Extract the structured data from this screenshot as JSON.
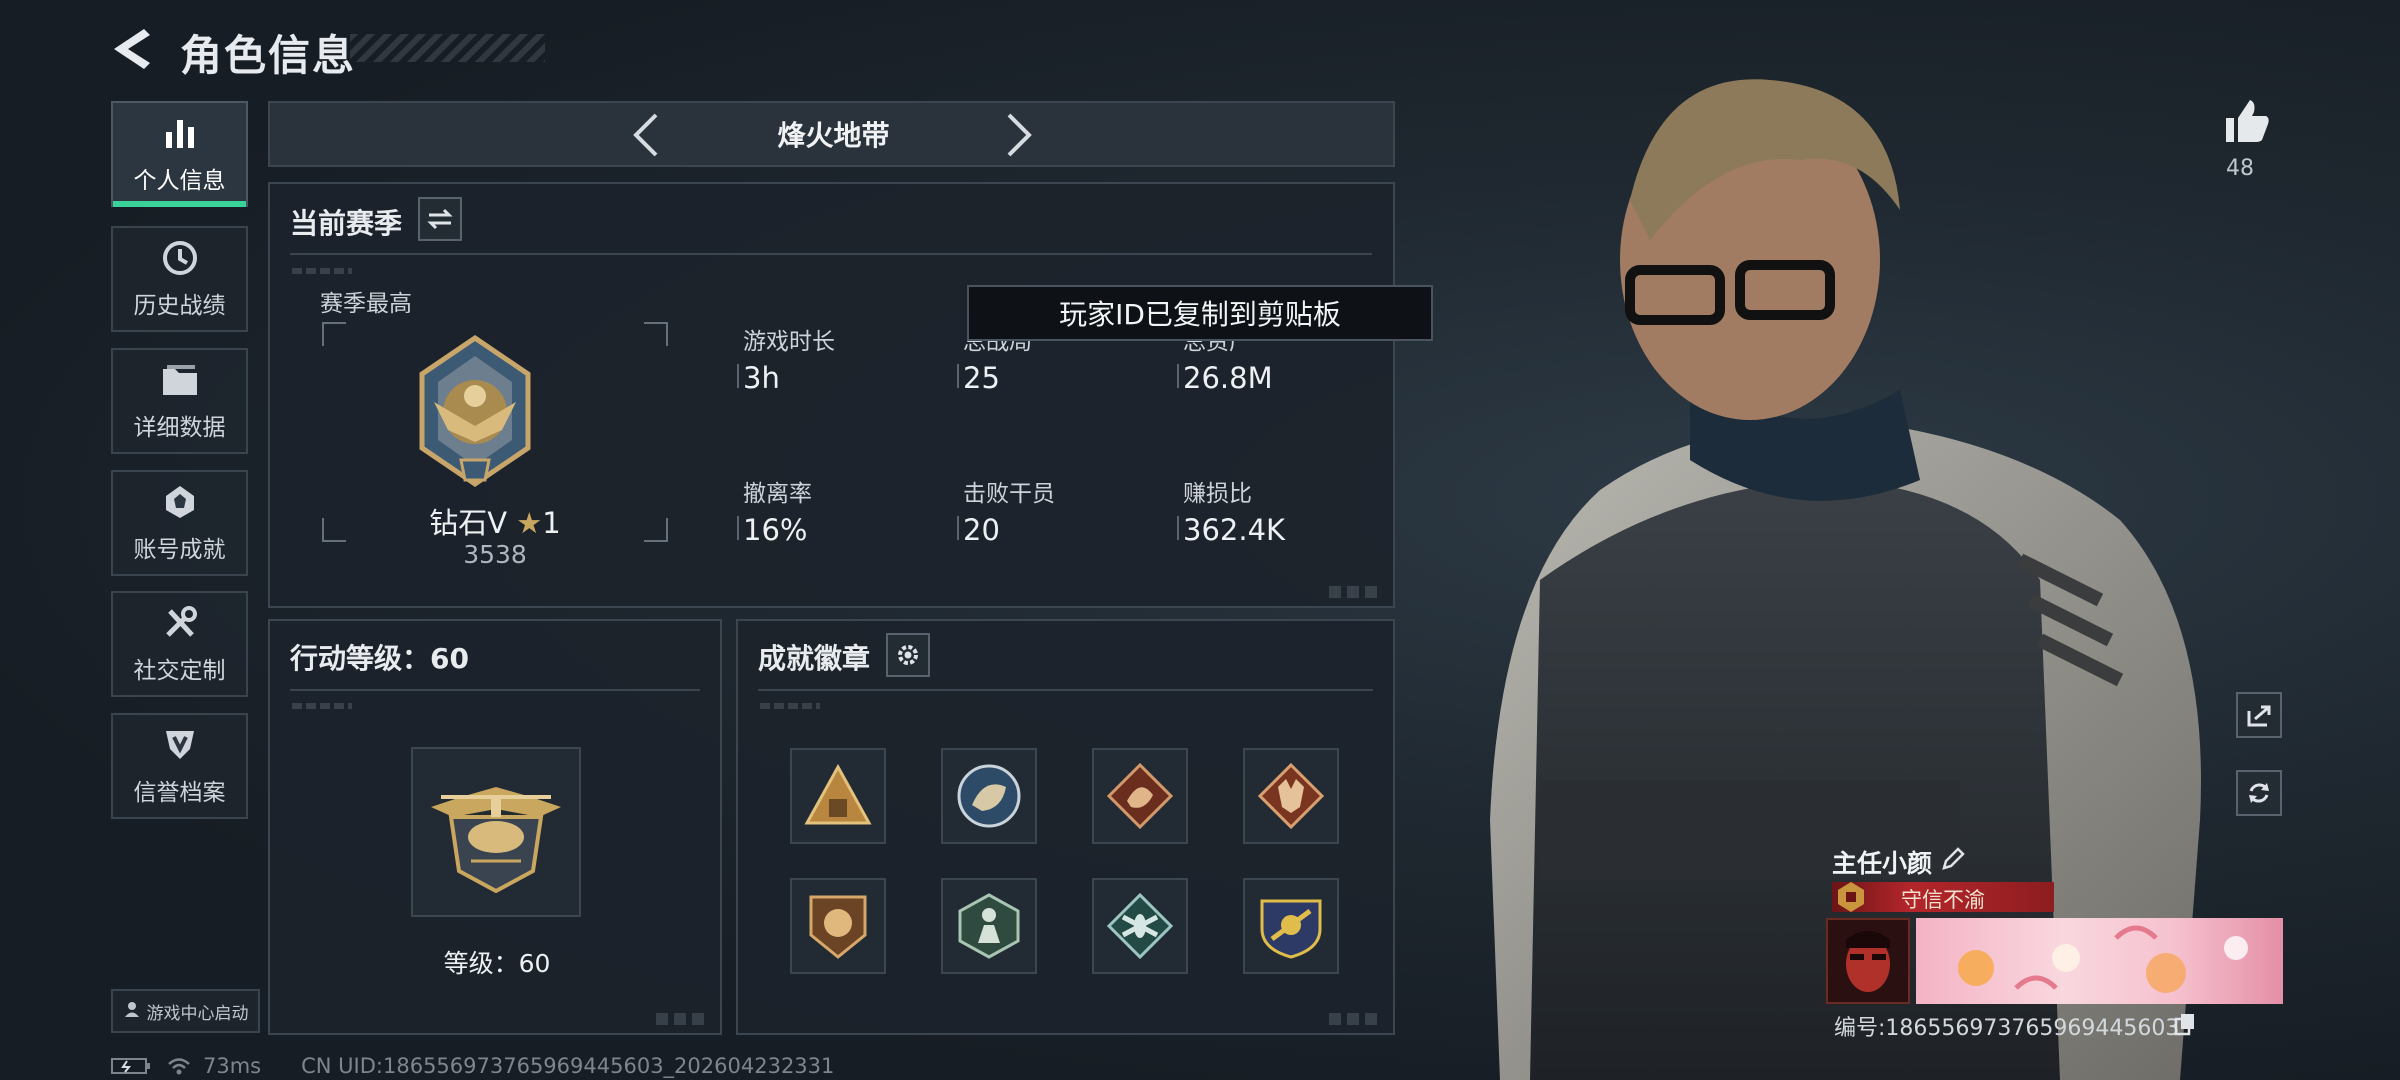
{
  "header": {
    "title": "角色信息"
  },
  "sidebar": {
    "items": [
      {
        "label": "个人信息",
        "icon": "bar-chart-icon",
        "active": true
      },
      {
        "label": "历史战绩",
        "icon": "history-clock-icon"
      },
      {
        "label": "详细数据",
        "icon": "folder-icon"
      },
      {
        "label": "账号成就",
        "icon": "achievement-icon"
      },
      {
        "label": "社交定制",
        "icon": "tools-icon"
      },
      {
        "label": "信誉档案",
        "icon": "shield-icon"
      }
    ],
    "launch_label": "游戏中心启动"
  },
  "mode_tab": {
    "title": "烽火地带"
  },
  "season": {
    "header": "当前赛季",
    "best_label": "赛季最高",
    "rank_name": "钻石V",
    "rank_stars": "1",
    "rank_score": "3538",
    "stats": [
      {
        "label": "游戏时长",
        "value": "3h"
      },
      {
        "label": "总战局",
        "value": "25"
      },
      {
        "label": "总资产",
        "value": "26.8M"
      },
      {
        "label": "撤离率",
        "value": "16%"
      },
      {
        "label": "击败干员",
        "value": "20"
      },
      {
        "label": "赚损比",
        "value": "362.4K"
      }
    ]
  },
  "toast": {
    "text": "玩家ID已复制到剪贴板"
  },
  "action_level": {
    "header": "行动等级：60",
    "level_label": "等级：60"
  },
  "achievements": {
    "header": "成就徽章",
    "badges": [
      "pyramid-badge-icon",
      "beast-badge-icon",
      "dragon-badge-icon",
      "wolf-badge-icon",
      "lion-badge-icon",
      "figure-badge-icon",
      "insect-badge-icon",
      "crest-badge-icon"
    ]
  },
  "profile": {
    "likes": "48",
    "player_name": "主任小颜",
    "title": "守信不渝",
    "id_label": "编号:1865569737659694456​03",
    "id_display": "编号:186556973765969445603"
  },
  "status_bar": {
    "ping": "73ms",
    "uid": "CN UID:186556973765969445603_202604232331"
  },
  "colors": {
    "accent_green": "#39d39a",
    "panel_border": "#3c4651",
    "title_red": "#b3262a",
    "banner_pink": "#f6b8c9"
  }
}
